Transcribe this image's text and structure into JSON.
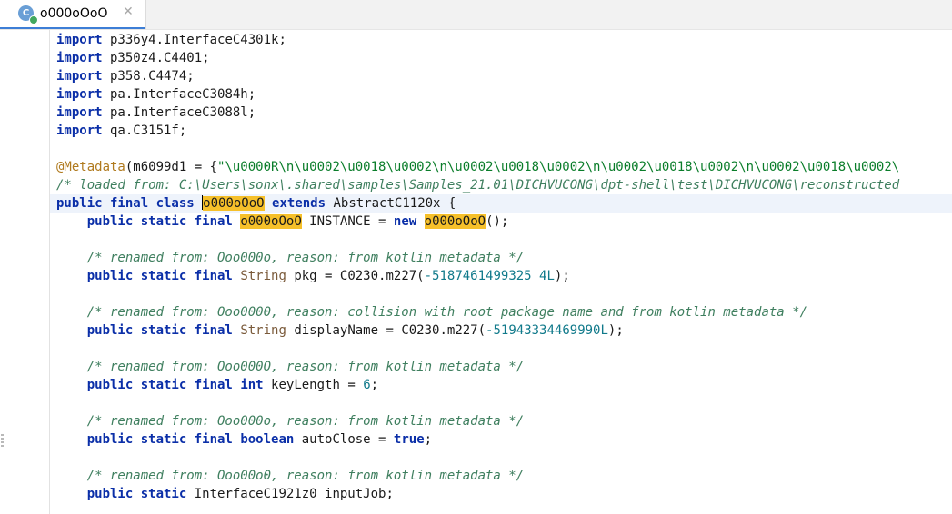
{
  "tab": {
    "icon_label": "C",
    "title": "o000oOoO",
    "close_glyph": "✕"
  },
  "code_lines": [
    [
      {
        "t": "import",
        "c": "kw"
      },
      {
        "t": " p336y4.InterfaceC4301k;",
        "c": "tx"
      }
    ],
    [
      {
        "t": "import",
        "c": "kw"
      },
      {
        "t": " p350z4.C4401;",
        "c": "tx"
      }
    ],
    [
      {
        "t": "import",
        "c": "kw"
      },
      {
        "t": " p358.C4474;",
        "c": "tx"
      }
    ],
    [
      {
        "t": "import",
        "c": "kw"
      },
      {
        "t": " pa.InterfaceC3084h;",
        "c": "tx"
      }
    ],
    [
      {
        "t": "import",
        "c": "kw"
      },
      {
        "t": " pa.InterfaceC3088l;",
        "c": "tx"
      }
    ],
    [
      {
        "t": "import",
        "c": "kw"
      },
      {
        "t": " qa.C3151f;",
        "c": "tx"
      }
    ],
    [],
    [
      {
        "t": "@Metadata",
        "c": "an"
      },
      {
        "t": "(m6099d1 = {",
        "c": "tx"
      },
      {
        "t": "\"\\u0000R\\n\\u0002\\u0018\\u0002\\n\\u0002\\u0018\\u0002\\n\\u0002\\u0018\\u0002\\n\\u0002\\u0018\\u0002\\",
        "c": "st"
      }
    ],
    [
      {
        "t": "/* loaded from: C:\\Users\\sonx\\.shared\\samples\\Samples_21.01\\DICHVUCONG\\dpt-shell\\test\\DICHVUCONG\\reconstructed",
        "c": "cm"
      }
    ],
    [
      {
        "t": "public final class",
        "c": "kw"
      },
      {
        "t": " ",
        "c": "tx"
      },
      {
        "t": "o000oOoO",
        "c": "hl",
        "caret": true
      },
      {
        "t": " ",
        "c": "tx"
      },
      {
        "t": "extends",
        "c": "kw"
      },
      {
        "t": " AbstractC1120x {",
        "c": "tx"
      }
    ],
    [
      {
        "t": "    ",
        "c": "tx"
      },
      {
        "t": "public static final",
        "c": "kw"
      },
      {
        "t": " ",
        "c": "tx"
      },
      {
        "t": "o000oOoO",
        "c": "hl"
      },
      {
        "t": " INSTANCE = ",
        "c": "tx"
      },
      {
        "t": "new",
        "c": "kw"
      },
      {
        "t": " ",
        "c": "tx"
      },
      {
        "t": "o000oOoO",
        "c": "hl"
      },
      {
        "t": "();",
        "c": "tx"
      }
    ],
    [],
    [
      {
        "t": "    /* renamed from: Ooo000o, reason: from kotlin metadata */",
        "c": "cm"
      }
    ],
    [
      {
        "t": "    ",
        "c": "tx"
      },
      {
        "t": "public static final",
        "c": "kw"
      },
      {
        "t": " ",
        "c": "tx"
      },
      {
        "t": "String",
        "c": "ty"
      },
      {
        "t": " pkg = C0230.m227(",
        "c": "tx"
      },
      {
        "t": "-5187461499325 4L",
        "c": "nm"
      },
      {
        "t": ");",
        "c": "tx"
      }
    ],
    [],
    [
      {
        "t": "    /* renamed from: Ooo0000, reason: collision with root package name and from kotlin metadata */",
        "c": "cm"
      }
    ],
    [
      {
        "t": "    ",
        "c": "tx"
      },
      {
        "t": "public static final",
        "c": "kw"
      },
      {
        "t": " ",
        "c": "tx"
      },
      {
        "t": "String",
        "c": "ty"
      },
      {
        "t": " displayName = C0230.m227(",
        "c": "tx"
      },
      {
        "t": "-51943334469990L",
        "c": "nm"
      },
      {
        "t": ");",
        "c": "tx"
      }
    ],
    [],
    [
      {
        "t": "    /* renamed from: Ooo000O, reason: from kotlin metadata */",
        "c": "cm"
      }
    ],
    [
      {
        "t": "    ",
        "c": "tx"
      },
      {
        "t": "public static final",
        "c": "kw"
      },
      {
        "t": " ",
        "c": "tx"
      },
      {
        "t": "int",
        "c": "kw"
      },
      {
        "t": " keyLength = ",
        "c": "tx"
      },
      {
        "t": "6",
        "c": "nm"
      },
      {
        "t": ";",
        "c": "tx"
      }
    ],
    [],
    [
      {
        "t": "    /* renamed from: Ooo000o, reason: from kotlin metadata */",
        "c": "cm"
      }
    ],
    [
      {
        "t": "    ",
        "c": "tx"
      },
      {
        "t": "public static final",
        "c": "kw"
      },
      {
        "t": " ",
        "c": "tx"
      },
      {
        "t": "boolean",
        "c": "kw"
      },
      {
        "t": " autoClose = ",
        "c": "tx"
      },
      {
        "t": "true",
        "c": "kw"
      },
      {
        "t": ";",
        "c": "tx"
      }
    ],
    [],
    [
      {
        "t": "    /* renamed from: Ooo00o0, reason: from kotlin metadata */",
        "c": "cm"
      }
    ],
    [
      {
        "t": "    ",
        "c": "tx"
      },
      {
        "t": "public static",
        "c": "kw"
      },
      {
        "t": " InterfaceC1921z0 inputJob;",
        "c": "tx"
      }
    ]
  ]
}
